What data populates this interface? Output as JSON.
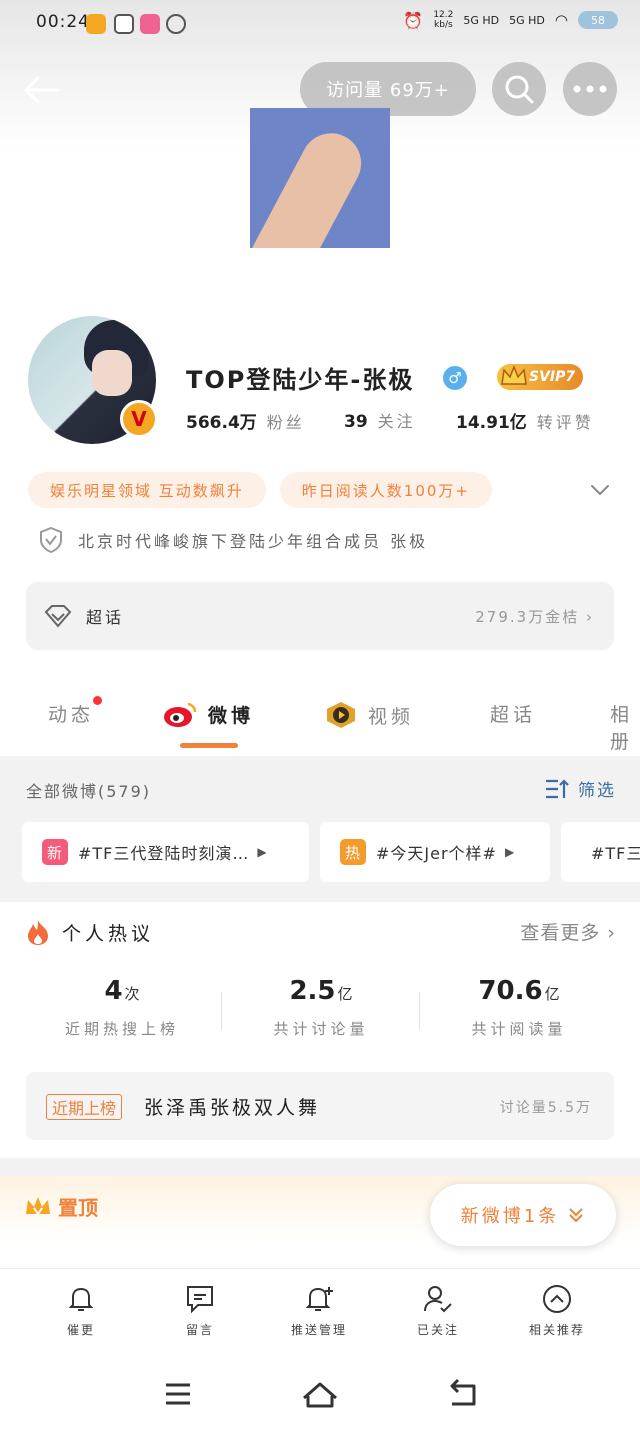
{
  "status_bar": {
    "time": "00:24",
    "speed_top": "12.2",
    "speed_bottom": "kb/s",
    "net1": "5G HD",
    "net2": "5G HD",
    "battery": "58"
  },
  "header": {
    "visits_label": "访问量 69万+"
  },
  "profile": {
    "name": "TOP登陆少年-张极",
    "gender_symbol": "♂",
    "vip_label": "SVIP7",
    "verified_badge": "V",
    "stats": [
      {
        "num": "566.4万",
        "label": "粉丝"
      },
      {
        "num": "39",
        "label": "关注"
      },
      {
        "num": "14.91亿",
        "label": "转评赞"
      }
    ],
    "tags": [
      "娱乐明星领域 互动数飙升",
      "昨日阅读人数100万+"
    ],
    "verification": "北京时代峰峻旗下登陆少年组合成员 张极",
    "chaohua": {
      "label": "超话",
      "value": "279.3万金桔"
    }
  },
  "tabs": [
    {
      "label": "动态"
    },
    {
      "label": "微博"
    },
    {
      "label": "视频"
    },
    {
      "label": "超话"
    },
    {
      "label": "相册"
    }
  ],
  "posts": {
    "all_label": "全部微博(579)",
    "filter_label": "筛选",
    "topics": [
      {
        "badge": "新",
        "text": "#TF三代登陆时刻演…",
        "color": "#f45a7a"
      },
      {
        "badge": "热",
        "text": "#今天Jer个样#",
        "color": "#f39b2c"
      },
      {
        "badge": "",
        "text": "#TF三",
        "color": ""
      }
    ]
  },
  "hot": {
    "title": "个人热议",
    "more": "查看更多",
    "stats": [
      {
        "num": "4",
        "unit": "次",
        "label": "近期热搜上榜"
      },
      {
        "num": "2.5",
        "unit": "亿",
        "label": "共计讨论量"
      },
      {
        "num": "70.6",
        "unit": "亿",
        "label": "共计阅读量"
      }
    ],
    "recent": {
      "badge": "近期上榜",
      "title": "张泽禹张极双人舞",
      "count": "讨论量5.5万"
    }
  },
  "pinned_label": "置顶",
  "new_posts_label": "新微博1条",
  "toolbar": [
    {
      "label": "催更",
      "icon": "bell-icon"
    },
    {
      "label": "留言",
      "icon": "message-icon"
    },
    {
      "label": "推送管理",
      "icon": "bell-plus-icon"
    },
    {
      "label": "已关注",
      "icon": "user-check-icon"
    },
    {
      "label": "相关推荐",
      "icon": "chevron-up-circle-icon"
    }
  ],
  "colors": {
    "accent": "#f0813b",
    "link": "#3a6ea5"
  }
}
